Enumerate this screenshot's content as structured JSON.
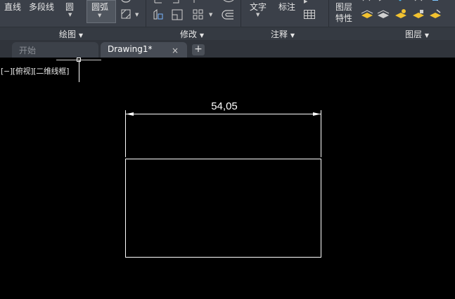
{
  "ribbon": {
    "draw": {
      "line_label": "直线",
      "polyline_label": "多段线",
      "circle_label": "圆",
      "arc_label": "圆弧",
      "panel_title": "绘图"
    },
    "modify": {
      "panel_title": "修改"
    },
    "annotation": {
      "text_label": "文字",
      "dimension_label": "标注",
      "panel_title": "注释"
    },
    "layers": {
      "properties_label_line1": "图层",
      "properties_label_line2": "特性",
      "panel_title": "图层"
    }
  },
  "tabs": [
    {
      "label": "开始"
    },
    {
      "label": "Drawing1*",
      "close": "×"
    }
  ],
  "tab_add_label": "+",
  "viewport": {
    "controls_label": "[−][俯视][二维线框]"
  },
  "drawing": {
    "dimension_value": "54,05",
    "line_color": "#ffffff"
  }
}
